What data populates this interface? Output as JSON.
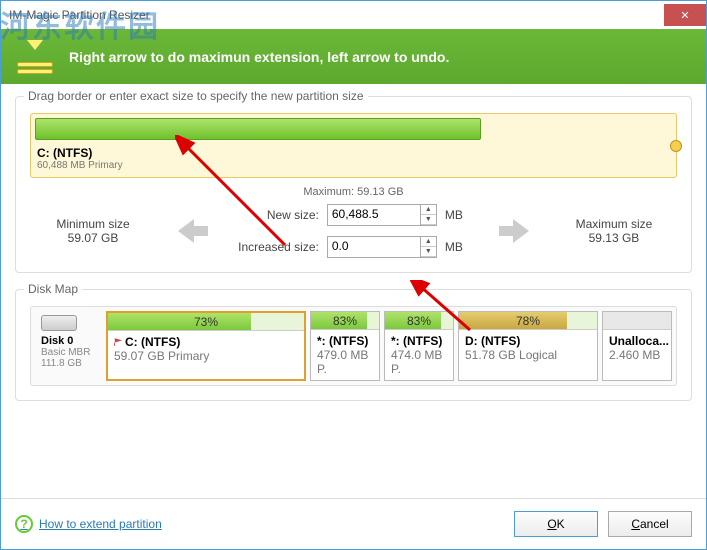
{
  "window": {
    "title": "IM-Magic Partition Resizer"
  },
  "banner": {
    "text": "Right arrow to do maximun extension, left arrow to undo."
  },
  "group1": {
    "label": "Drag border or enter exact size to specify the new partition size",
    "partition_name": "C: (NTFS)",
    "partition_sub": "60,488 MB Primary",
    "max_label": "Maximum: 59.13 GB",
    "min_title": "Minimum size",
    "min_val": "59.07 GB",
    "max_title": "Maximum size",
    "max_val": "59.13 GB",
    "new_label": "New size:",
    "new_value": "60,488.5",
    "inc_label": "Increased size:",
    "inc_value": "0.0",
    "unit": "MB"
  },
  "diskmap": {
    "label": "Disk Map",
    "disk_name": "Disk 0",
    "disk_type": "Basic MBR",
    "disk_size": "111.8 GB",
    "parts": [
      {
        "pct": "73%",
        "fill": 73,
        "name": "C: (NTFS)",
        "sub": "59.07 GB Primary",
        "selected": true,
        "flag": true,
        "gold": false
      },
      {
        "pct": "83%",
        "fill": 83,
        "name": "*: (NTFS)",
        "sub": "479.0 MB P.",
        "selected": false,
        "flag": false,
        "gold": false
      },
      {
        "pct": "83%",
        "fill": 83,
        "name": "*: (NTFS)",
        "sub": "474.0 MB P.",
        "selected": false,
        "flag": false,
        "gold": false
      },
      {
        "pct": "78%",
        "fill": 78,
        "name": "D: (NTFS)",
        "sub": "51.78 GB Logical",
        "selected": false,
        "flag": false,
        "gold": true
      }
    ],
    "unalloc_name": "Unalloca...",
    "unalloc_size": "2.460 MB"
  },
  "footer": {
    "help": "How to extend partition",
    "ok": "OK",
    "cancel": "Cancel"
  },
  "watermark": "河东软件园"
}
